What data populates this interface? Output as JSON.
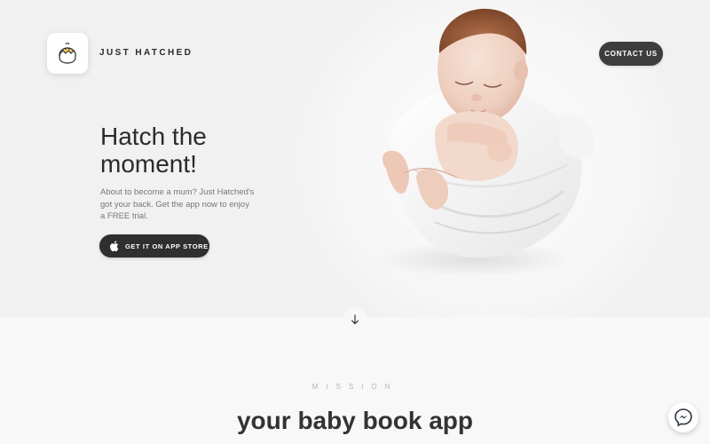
{
  "header": {
    "brand_name": "JUST HATCHED",
    "logo_icon": "hatching-chick-icon",
    "contact_label": "CONTACT US"
  },
  "hero": {
    "headline_line1": "Hatch the",
    "headline_line2": "moment!",
    "subtext": "About to become a mum? Just Hatched's got your back. Get the app now to enjoy a FREE trial.",
    "app_store_label": "GET IT ON APP STORE",
    "app_store_icon": "apple-icon",
    "image_subject": "sleeping newborn wrapped in white blanket"
  },
  "scroll": {
    "icon": "arrow-down-icon"
  },
  "mission": {
    "label": "MISSION",
    "title": "your baby book app"
  },
  "chat": {
    "icon": "messenger-icon"
  },
  "colors": {
    "hero_bg": "#f1f1f1",
    "button_dark": "#3d3d3d",
    "logo_accent": "#f3d46b",
    "text_dark": "#2b2b2b"
  }
}
